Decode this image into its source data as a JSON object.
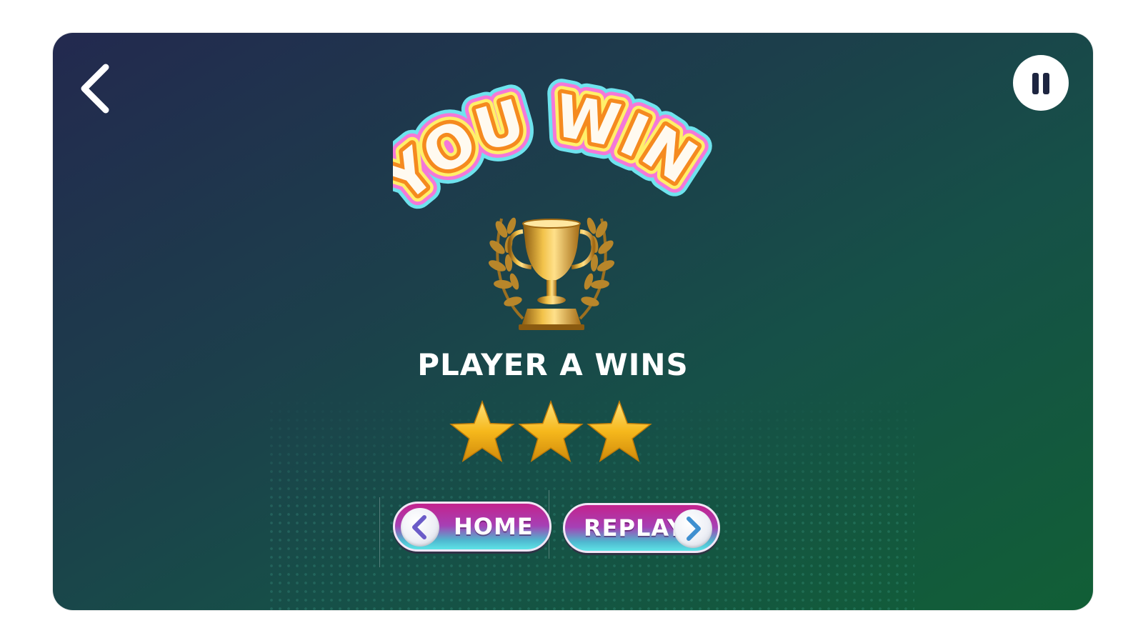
{
  "title": {
    "text": "YOU WIN!"
  },
  "result": {
    "winner_text": "PLAYER A WINS"
  },
  "rating": {
    "stars_earned": 3,
    "stars_total": 3
  },
  "buttons": {
    "home_label": "HOME",
    "replay_label": "REPLAY"
  },
  "icons": {
    "back": "chevron-left-icon",
    "pause": "pause-icon",
    "trophy": "trophy-icon",
    "star": "star-icon",
    "home_arrow": "chevron-left-icon",
    "replay_arrow": "chevron-right-icon"
  },
  "colors": {
    "background_start": "#23294f",
    "background_end": "#115f36",
    "star_gold": "#f6b81c",
    "button_top": "#c3238d",
    "button_bottom": "#5ee4e6",
    "title_orange": "#f58a1f"
  }
}
